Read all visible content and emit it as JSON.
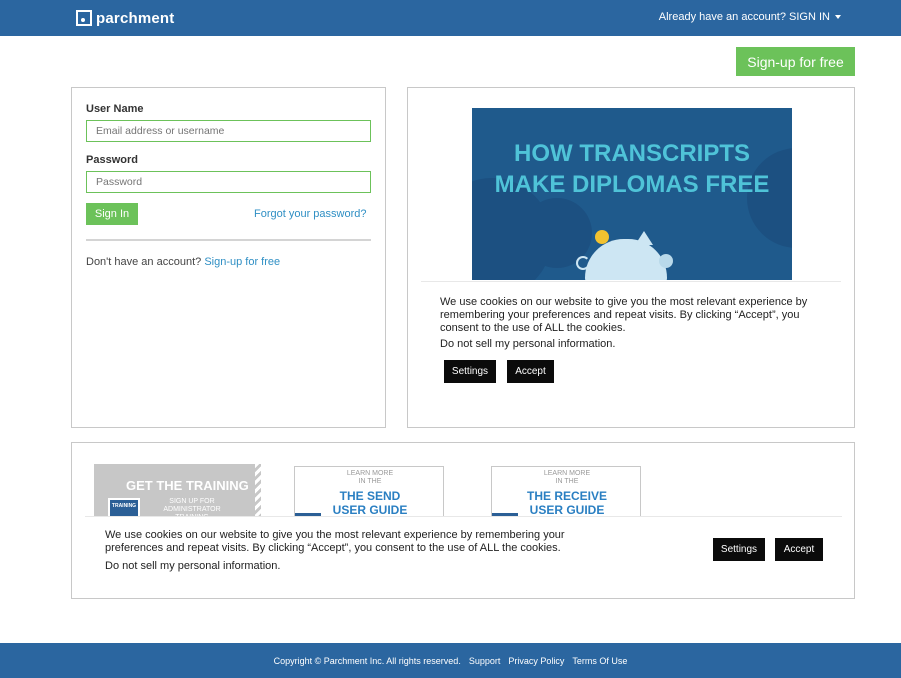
{
  "header": {
    "logo_text": "parchment",
    "signin_link": "Already have an account? SIGN IN"
  },
  "signup_button": "Sign-up for free",
  "login": {
    "username_label": "User Name",
    "username_placeholder": "Email address or username",
    "password_label": "Password",
    "password_placeholder": "Password",
    "signin_button": "Sign In",
    "forgot_link": "Forgot your password?",
    "no_account_text": "Don't have an account?",
    "no_account_link": "Sign-up for free"
  },
  "promo": {
    "video_title_line1": "HOW TRANSCRIPTS",
    "video_title_line2": "MAKE DIPLOMAS FREE"
  },
  "cookie_inline": {
    "text": "We use cookies on our website to give you the most relevant experience by remembering your preferences and repeat visits. By clicking “Accept”, you consent to the use of ALL the cookies.",
    "do_not_sell": "Do not sell my personal information.",
    "settings_button": "Settings",
    "accept_button": "Accept"
  },
  "resources": {
    "training_title": "GET THE TRAINING",
    "training_sub": "SIGN UP FOR ADMINISTRATOR TRAINING",
    "training_icon_text": "TRAINING",
    "send_guide_small1": "LEARN MORE",
    "send_guide_small2": "IN THE",
    "send_guide_title1": "THE SEND",
    "send_guide_title2": "USER GUIDE",
    "receive_guide_small1": "LEARN MORE",
    "receive_guide_small2": "IN THE",
    "receive_guide_title1": "THE RECEIVE",
    "receive_guide_title2": "USER GUIDE"
  },
  "cookie_banner": {
    "text": "We use cookies on our website to give you the most relevant experience by remembering your preferences and repeat visits. By clicking “Accept”, you consent to the use of ALL the cookies.",
    "do_not_sell": "Do not sell my personal information.",
    "settings_button": "Settings",
    "accept_button": "Accept"
  },
  "footer": {
    "copyright": "Copyright © Parchment Inc. All rights reserved.",
    "support": "Support",
    "privacy": "Privacy Policy",
    "terms": "Terms Of Use"
  },
  "colors": {
    "brand_blue": "#2b66a0",
    "accent_green": "#6cc25a",
    "link_blue": "#2f8fc4"
  }
}
